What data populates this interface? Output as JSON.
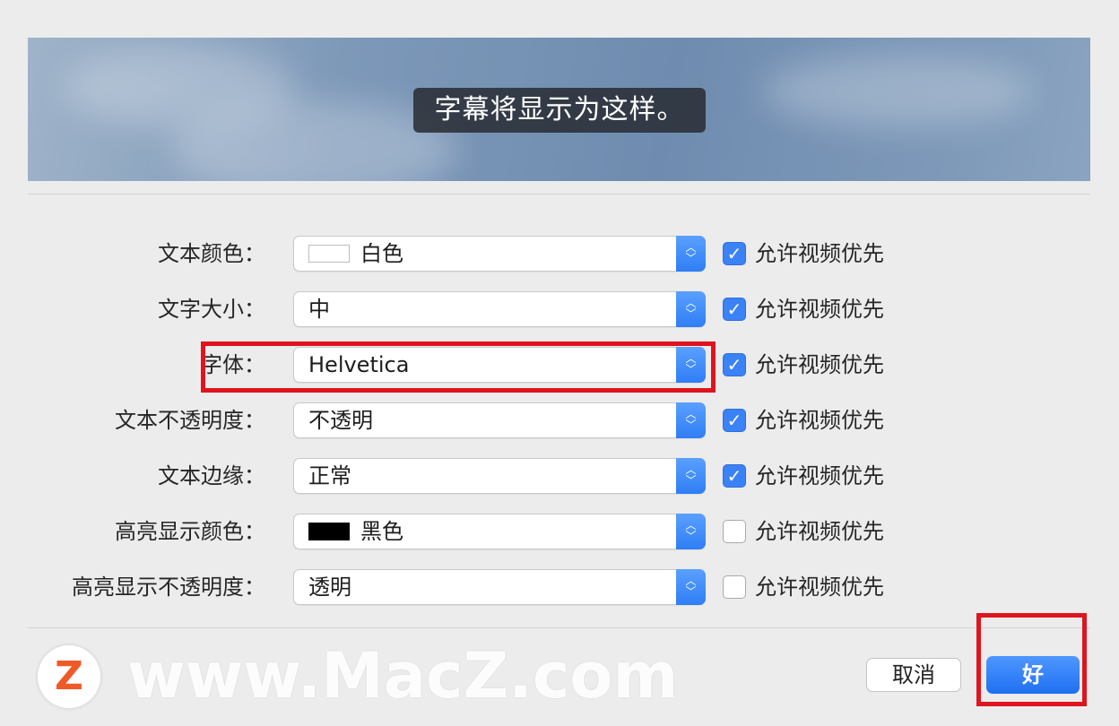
{
  "preview": {
    "caption": "字幕将显示为这样。"
  },
  "rows": [
    {
      "label": "文本颜色：",
      "value": "白色",
      "swatch": "#ffffff",
      "allow_video": true,
      "allow_label": "允许视频优先"
    },
    {
      "label": "文字大小：",
      "value": "中",
      "swatch": null,
      "allow_video": true,
      "allow_label": "允许视频优先"
    },
    {
      "label": "字体：",
      "value": "Helvetica",
      "swatch": null,
      "allow_video": true,
      "allow_label": "允许视频优先"
    },
    {
      "label": "文本不透明度：",
      "value": "不透明",
      "swatch": null,
      "allow_video": true,
      "allow_label": "允许视频优先"
    },
    {
      "label": "文本边缘：",
      "value": "正常",
      "swatch": null,
      "allow_video": true,
      "allow_label": "允许视频优先"
    },
    {
      "label": "高亮显示颜色：",
      "value": "黑色",
      "swatch": "#000000",
      "allow_video": false,
      "allow_label": "允许视频优先"
    },
    {
      "label": "高亮显示不透明度：",
      "value": "透明",
      "swatch": null,
      "allow_video": false,
      "allow_label": "允许视频优先"
    }
  ],
  "buttons": {
    "cancel": "取消",
    "ok": "好"
  },
  "watermark": {
    "logo_letter": "Z",
    "text": "www.MacZ.com"
  },
  "colors": {
    "accent": "#3b82f6",
    "highlight": "#e0141e"
  }
}
